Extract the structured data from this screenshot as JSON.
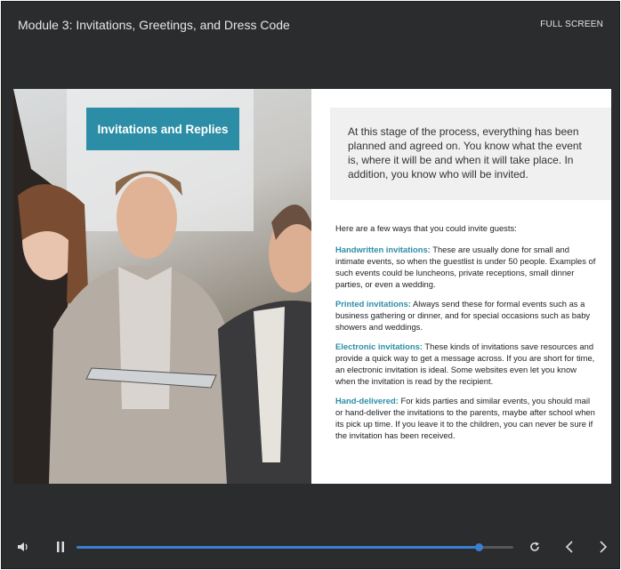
{
  "header": {
    "title": "Module 3: Invitations, Greetings, and Dress Code",
    "fullscreen_label": "FULL SCREEN"
  },
  "slide": {
    "title": "Invitations and Replies",
    "intro": "At this stage of the process, everything has been planned and agreed on. You know what the event is, where it will be and when it will take place. In addition, you know who will be invited.",
    "lead": "Here are a few ways that you could invite guests:",
    "items": [
      {
        "term": "Handwritten invitations:",
        "text": " These are usually done for small and intimate events, so when the guestlist is under 50 people. Examples of such events could be luncheons, private receptions, small dinner parties, or even a wedding."
      },
      {
        "term": "Printed invitations:",
        "text": " Always send these for formal events such as a business gathering or dinner, and for special occasions such as baby showers and weddings."
      },
      {
        "term": "Electronic invitations:",
        "text": " These kinds of invitations save resources and provide a quick way to get a message across. If you are short for time, an electronic invitation is ideal. Some websites even let you know when the invitation is read by the recipient."
      },
      {
        "term": "Hand-delivered:",
        "text": " For kids parties and similar events, you should mail or hand-deliver the invitations to the parents, maybe after school when its pick up time. If you leave it to the children, you can never be sure if the invitation has been received."
      }
    ]
  },
  "player": {
    "progress": 0.92,
    "accent": "#3b7fd4",
    "icons": {
      "volume": "speaker-icon",
      "pause": "pause-icon",
      "replay": "replay-icon",
      "prev": "chevron-left-icon",
      "next": "chevron-right-icon"
    }
  },
  "colors": {
    "frame_bg": "#2b2c2e",
    "title_box": "#2c8ea6",
    "intro_box": "#f0f0f0",
    "term": "#2c8ea6"
  }
}
